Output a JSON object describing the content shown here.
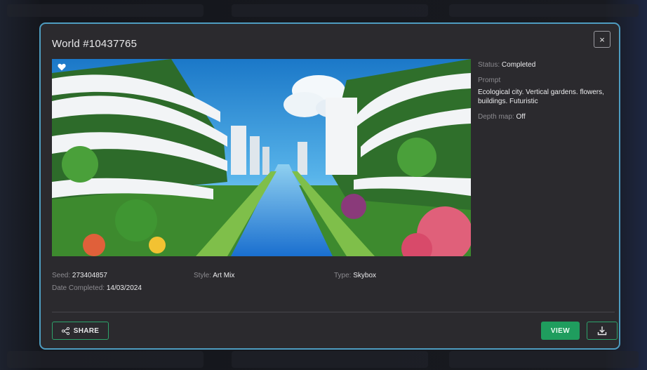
{
  "modal": {
    "title": "World #10437765",
    "close_glyph": "×",
    "details": {
      "status_label": "Status:",
      "status_value": "Completed",
      "prompt_label": "Prompt",
      "prompt_value": "Ecological city. Vertical gardens. flowers, buildings. Futuristic",
      "depth_label": "Depth map:",
      "depth_value": "Off"
    },
    "meta": {
      "seed_label": "Seed:",
      "seed_value": "273404857",
      "date_label": "Date Completed:",
      "date_value": "14/03/2024",
      "style_label": "Style:",
      "style_value": "Art Mix",
      "type_label": "Type:",
      "type_value": "Skybox"
    },
    "actions": {
      "share_label": "SHARE",
      "view_label": "VIEW"
    },
    "icons": {
      "favorite": "heart-icon",
      "share": "share-icon",
      "download": "download-icon",
      "close": "close-icon"
    },
    "colors": {
      "accent_green": "#1f9d5e",
      "modal_border": "#4e9cc0",
      "modal_bg": "#2b2a2e"
    }
  }
}
